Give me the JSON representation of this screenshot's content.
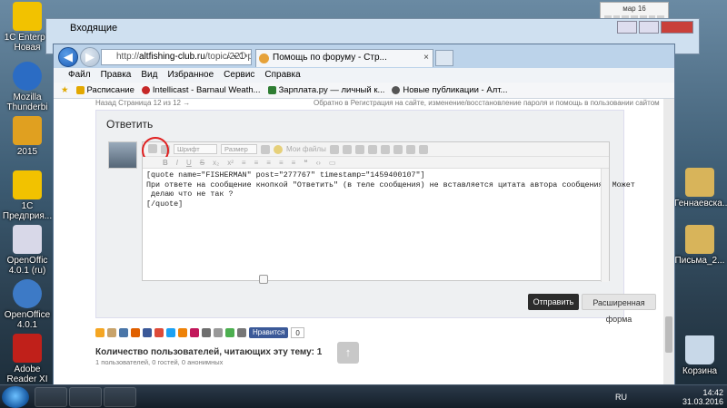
{
  "desktop": {
    "icons_left": [
      {
        "label": "1C Enterpri Новая",
        "color": "#f2c200"
      },
      {
        "label": "Mozilla Thunderbi",
        "color": "#2b6cc4"
      },
      {
        "label": "2015",
        "color": "#e0a020"
      },
      {
        "label": "1С Предприя...",
        "color": "#f2c200"
      },
      {
        "label": "OpenOffic 4.0.1 (ru)",
        "color": "#d8d8e8"
      },
      {
        "label": "OpenOffice 4.0.1",
        "color": "#3d7ac6"
      },
      {
        "label": "Adobe Reader XI",
        "color": "#c0201a"
      }
    ],
    "icons_right": [
      {
        "label": "Геннаевска...",
        "color": "#d8b45a"
      },
      {
        "label": "Письма_2...",
        "color": "#d8b45a"
      },
      {
        "label": "Корзина",
        "color": "#c8d8e8"
      }
    ],
    "calendar": {
      "label": "мар 16"
    }
  },
  "back_window": {
    "title": "Входящие"
  },
  "browser": {
    "address": {
      "url_prefix": "http://",
      "url_domain": "altfishing-club.ru",
      "url_rest": "/topic/221-pomc"
    },
    "tab": {
      "title": "Помощь по форуму - Стр...",
      "close": "×"
    },
    "menu": [
      "Файл",
      "Правка",
      "Вид",
      "Избранное",
      "Сервис",
      "Справка"
    ],
    "favorites": [
      {
        "label": "Расписание",
        "color": "#e3a800"
      },
      {
        "label": "Intellicast - Barnaul Weath...",
        "color": "#c62828"
      },
      {
        "label": "Зарплата.ру — личный к...",
        "color": "#2e7d32"
      },
      {
        "label": "Новые публикации - Алт...",
        "color": "#555555"
      }
    ]
  },
  "page": {
    "crumb_left": "Назад  Страница 12 из 12  →",
    "crumb_right": "Обратно в Регистрация на сайте, изменение/восстановление пароля и помощь в пользовании сайтом",
    "reply_title": "Ответить",
    "toolbar": {
      "font_select": "Шрифт",
      "size_select": "Размер",
      "my_files": "Мои файлы"
    },
    "editor_lines": [
      "[quote name=\"FISHERMAN\" post=\"277767\" timestamp=\"1459400107\"]",
      "При ответе на сообщение кнопкой \"Ответить\" (в теле сообщения) не вставляется цитата автора сообщения. Может",
      " делаю что не так ?",
      "[/quote]"
    ],
    "submit_label": "Отправить",
    "advanced_label": "Расширенная форма",
    "vk_label": "Нравится",
    "vk_count": "0",
    "users_title": "Количество пользователей, читающих эту тему: 1",
    "users_sub": "1 пользователей, 0 гостей, 0 анонимных",
    "up_icon": "↑"
  },
  "taskbar": {
    "lang": "RU",
    "time": "14:42",
    "date": "31.03.2016"
  }
}
